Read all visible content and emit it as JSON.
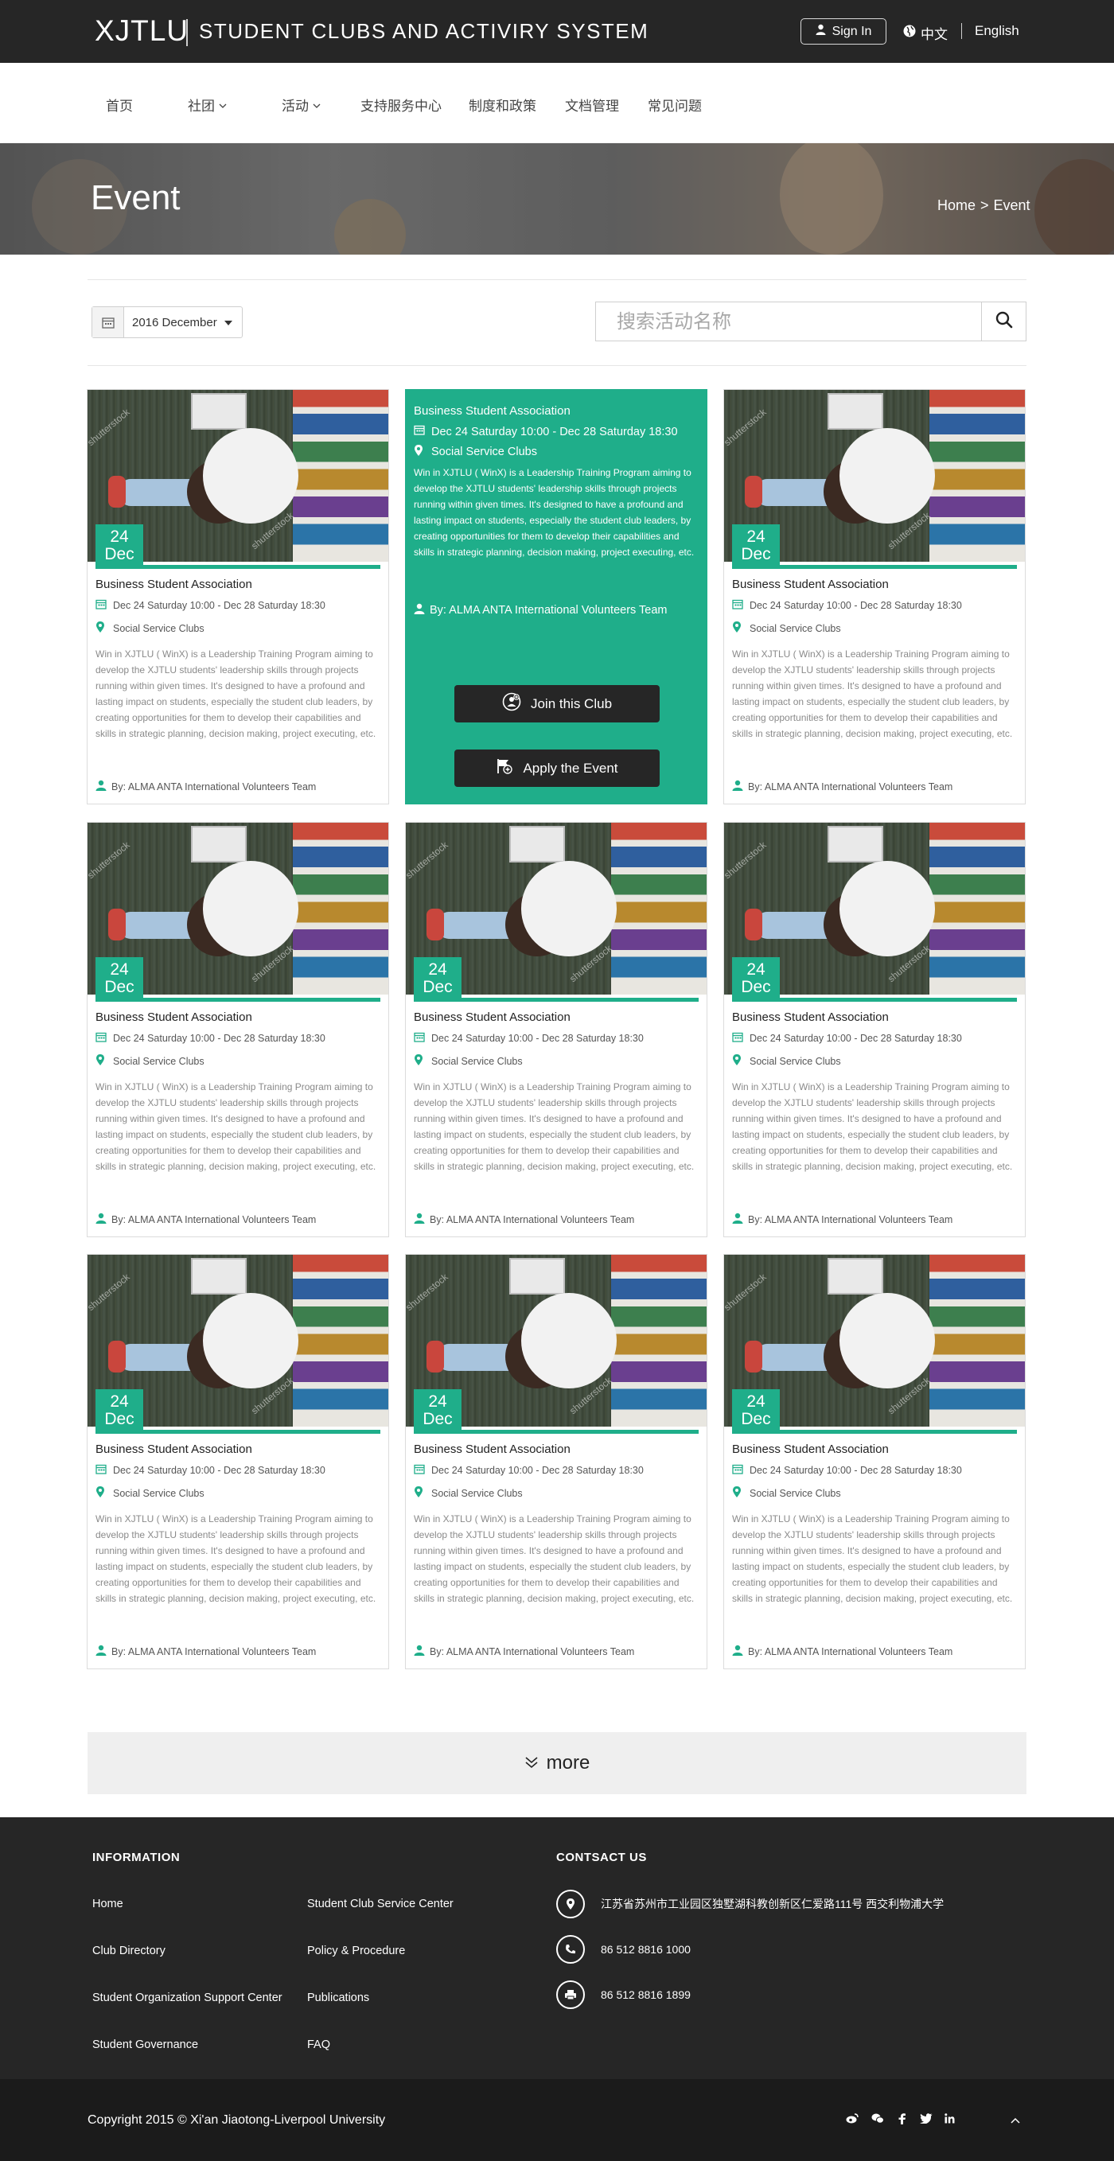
{
  "header": {
    "logo": "XJTLU",
    "title": "STUDENT CLUBS AND ACTIVIRY SYSTEM",
    "sign_in": "Sign In",
    "lang_zh": "中文",
    "lang_en": "English"
  },
  "nav": {
    "items": [
      {
        "label": "首页",
        "dropdown": false
      },
      {
        "label": "社团",
        "dropdown": true
      },
      {
        "label": "活动",
        "dropdown": true
      },
      {
        "label": "支持服务中心",
        "dropdown": false
      },
      {
        "label": "制度和政策",
        "dropdown": false
      },
      {
        "label": "文档管理",
        "dropdown": false
      },
      {
        "label": "常见问题",
        "dropdown": false
      }
    ]
  },
  "banner": {
    "title": "Event",
    "breadcrumb": {
      "home": "Home",
      "sep": ">",
      "current": "Event"
    }
  },
  "filter": {
    "date_value": "2016   December",
    "search_placeholder": "搜索活动名称"
  },
  "card": {
    "day": "24",
    "month": "Dec",
    "org": "Business Student Association",
    "time": "Dec 24  Saturday 10:00 - Dec 28  Saturday 18:30",
    "location": "Social Service Clubs",
    "description": "Win in XJTLU ( WinX) is a Leadership Training Program aiming to develop the XJTLU students' leadership skills through projects running within given times. It's designed to have a profound and lasting impact on students, especially the student club leaders, by creating opportunities for them to develop their capabilities and skills in strategic planning, decision making, project executing, etc.",
    "by": "By: ALMA ANTA International Volunteers Team",
    "watermark": "shutterstock"
  },
  "featured": {
    "join_label": "Join this Club",
    "apply_label": "Apply the Event"
  },
  "more_label": "more",
  "footer": {
    "info_heading": "INFORMATION",
    "contact_heading": "CONTSACT US",
    "links_col1": [
      "Home",
      "Club Directory",
      "Student Organization Support Center",
      "Student Governance"
    ],
    "links_col2": [
      "Student Club Service Center",
      "Policy & Procedure",
      "Publications",
      "FAQ"
    ],
    "address": "江苏省苏州市工业园区独墅湖科教创新区仁爱路111号  西交利物浦大学",
    "phone": "86 512 8816 1000",
    "fax": "86 512 8816 1899",
    "copyright": "Copyright 2015 © Xi'an Jiaotong-Liverpool University",
    "social": [
      "weibo-icon",
      "wechat-icon",
      "facebook-icon",
      "twitter-icon",
      "linkedin-icon"
    ]
  },
  "colors": {
    "accent": "#1fae8a",
    "dark": "#262626"
  }
}
